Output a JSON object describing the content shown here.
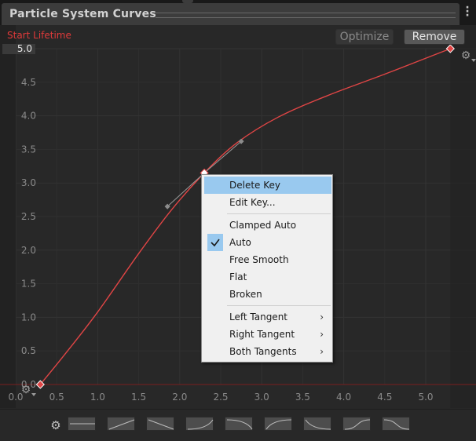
{
  "window": {
    "title": "Particle System Curves",
    "menu_icon": "kebab-menu-icon"
  },
  "curve": {
    "name": "Start Lifetime",
    "color": "#e04545",
    "y_max_field": "5.0"
  },
  "buttons": {
    "optimize": "Optimize",
    "remove": "Remove"
  },
  "chart_data": {
    "type": "line",
    "series": [
      {
        "name": "Start Lifetime",
        "keys": [
          {
            "x": 0.3,
            "y": 0.0
          },
          {
            "x": 2.3,
            "y": 3.15
          },
          {
            "x": 5.3,
            "y": 5.0
          }
        ],
        "curve_samples": [
          {
            "x": 0.3,
            "y": 0.0
          },
          {
            "x": 0.6,
            "y": 0.45
          },
          {
            "x": 1.0,
            "y": 1.08
          },
          {
            "x": 1.5,
            "y": 1.95
          },
          {
            "x": 1.9,
            "y": 2.6
          },
          {
            "x": 2.3,
            "y": 3.15
          },
          {
            "x": 2.7,
            "y": 3.6
          },
          {
            "x": 3.2,
            "y": 3.98
          },
          {
            "x": 3.8,
            "y": 4.3
          },
          {
            "x": 4.5,
            "y": 4.62
          },
          {
            "x": 5.3,
            "y": 5.0
          }
        ],
        "selected_key_tangents": [
          {
            "x": 1.85,
            "y": 2.65
          },
          {
            "x": 2.75,
            "y": 3.62
          }
        ]
      }
    ],
    "x_ticks": [
      "0.0",
      "0.5",
      "1.0",
      "1.5",
      "2.0",
      "2.5",
      "3.0",
      "3.5",
      "4.0",
      "4.5",
      "5.0"
    ],
    "y_ticks": [
      "0.0",
      "0.5",
      "1.0",
      "1.5",
      "2.0",
      "2.5",
      "3.0",
      "3.5",
      "4.0",
      "4.5"
    ],
    "xlim": [
      0.0,
      5.3
    ],
    "ylim": [
      0.0,
      5.0
    ],
    "grid": true
  },
  "context_menu": {
    "items": [
      {
        "label": "Delete Key",
        "highlighted": true
      },
      {
        "label": "Edit Key..."
      },
      {
        "separator": true
      },
      {
        "label": "Clamped Auto"
      },
      {
        "label": "Auto",
        "checked": true
      },
      {
        "label": "Free Smooth"
      },
      {
        "label": "Flat"
      },
      {
        "label": "Broken"
      },
      {
        "separator": true
      },
      {
        "label": "Left Tangent",
        "submenu": true
      },
      {
        "label": "Right Tangent",
        "submenu": true
      },
      {
        "label": "Both Tangents",
        "submenu": true
      }
    ]
  },
  "presets": {
    "gear_icon": "gear-icon",
    "items": [
      {
        "name": "preset-constant",
        "shape": "flat"
      },
      {
        "name": "preset-linear-up",
        "shape": "linear-up"
      },
      {
        "name": "preset-linear-down",
        "shape": "linear-down"
      },
      {
        "name": "preset-ease-in",
        "shape": "ease-in"
      },
      {
        "name": "preset-ease-out-down",
        "shape": "ease-out-down"
      },
      {
        "name": "preset-ease-out",
        "shape": "ease-out"
      },
      {
        "name": "preset-ease-in-down",
        "shape": "ease-in-down"
      },
      {
        "name": "preset-ease-in-out",
        "shape": "ease-in-out"
      },
      {
        "name": "preset-ease-in-out-down",
        "shape": "ease-in-out-down"
      }
    ]
  }
}
